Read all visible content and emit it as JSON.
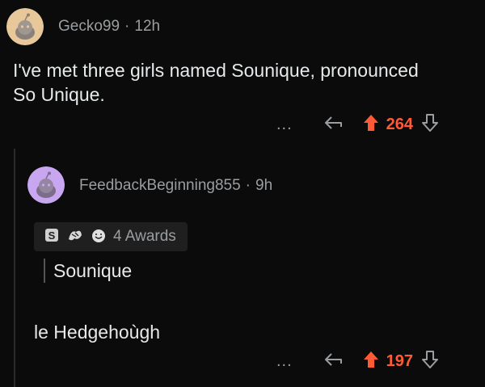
{
  "comments": [
    {
      "username": "Gecko99",
      "time": "12h",
      "body_lines": [
        "I've met three girls named Sounique, pronounced",
        "So Unique."
      ],
      "more": "...",
      "score": "264",
      "avatar_color": "#e8c79a"
    },
    {
      "username": "FeedbackBeginning855",
      "time": "9h",
      "awards_label": "4 Awards",
      "quote": "Sounique",
      "body": "le Hedgehoùgh",
      "more": "...",
      "score": "197",
      "avatar_color": "#c9a6f0"
    }
  ],
  "separator": "·",
  "colors": {
    "background": "#0b0b0b",
    "upvote": "#ff5a36",
    "muted": "#9a9ea1"
  }
}
